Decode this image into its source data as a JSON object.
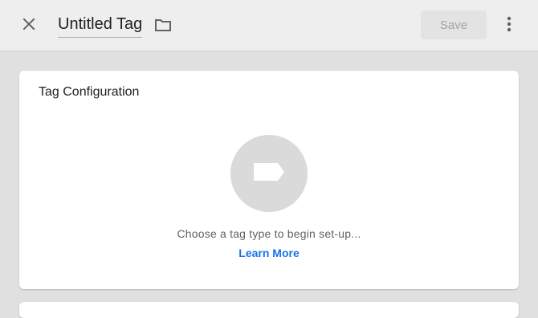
{
  "header": {
    "close_icon": "close-icon",
    "title": "Untitled Tag",
    "folder_icon": "folder-icon",
    "save_label": "Save",
    "more_icon": "more-vert-icon"
  },
  "tag_configuration": {
    "title": "Tag Configuration",
    "tag_icon": "tag-icon",
    "prompt": "Choose a tag type to begin set-up...",
    "learn_more": "Learn More"
  },
  "colors": {
    "accent": "#1a73e8",
    "background": "#e0e0e0",
    "topbar": "#eeeeee",
    "save_disabled_bg": "#e3e3e3",
    "save_disabled_text": "#a4a4a4",
    "icon_circle": "#dadada"
  }
}
